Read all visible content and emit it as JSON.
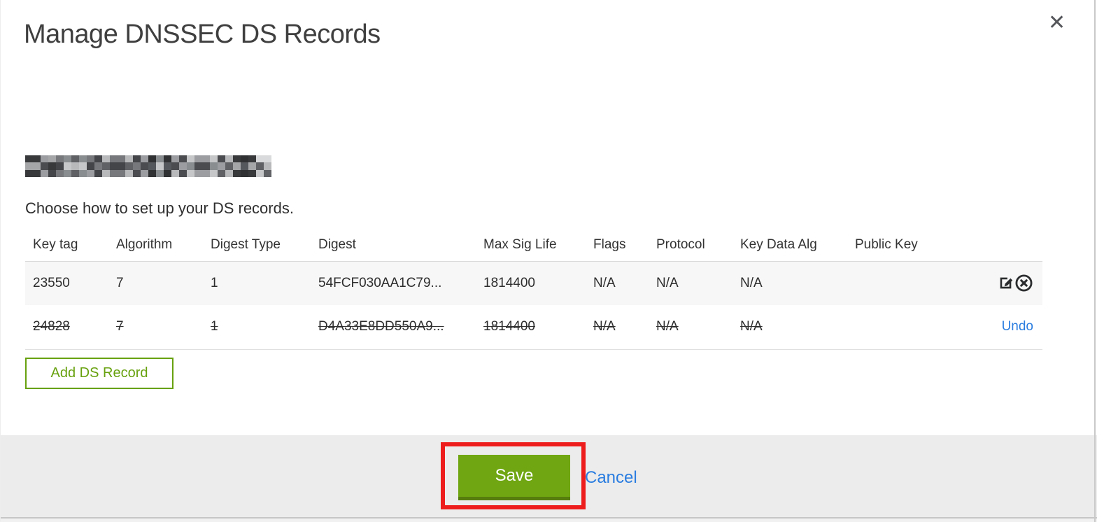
{
  "header": {
    "title": "Manage DNSSEC DS Records",
    "close_icon": "close-x-glyph"
  },
  "intro": {
    "domain_redacted": "[redacted domain name]",
    "subtitle": "Choose how to set up your DS records."
  },
  "table": {
    "columns": [
      "Key tag",
      "Algorithm",
      "Digest Type",
      "Digest",
      "Max Sig Life",
      "Flags",
      "Protocol",
      "Key Data Alg",
      "Public Key"
    ],
    "rows": [
      {
        "key_tag": "23550",
        "algorithm": "7",
        "digest_type": "1",
        "digest": "54FCF030AA1C79...",
        "max_sig_life": "1814400",
        "flags": "N/A",
        "protocol": "N/A",
        "key_data_alg": "N/A",
        "public_key": "",
        "state": "active",
        "icons": [
          "edit-icon",
          "delete-icon"
        ]
      },
      {
        "key_tag": "24828",
        "algorithm": "7",
        "digest_type": "1",
        "digest": "D4A33E8DD550A9...",
        "max_sig_life": "1814400",
        "flags": "N/A",
        "protocol": "N/A",
        "key_data_alg": "N/A",
        "public_key": "",
        "state": "deleted",
        "action_label": "Undo"
      }
    ]
  },
  "actions": {
    "add_ds_record": "Add DS Record",
    "save": "Save",
    "cancel": "Cancel"
  },
  "annotations": {
    "save_highlight": "red rectangle around Save button"
  },
  "colors": {
    "accent_green": "#6fa611",
    "green_dark": "#567d0e",
    "outline_green": "#67a10e",
    "link_blue": "#2a7de0",
    "annotation_red": "#ee1d1d",
    "footer_gray": "#ececec",
    "row_shade": "#f7f7f7",
    "text_dark": "#2d2d2d"
  }
}
